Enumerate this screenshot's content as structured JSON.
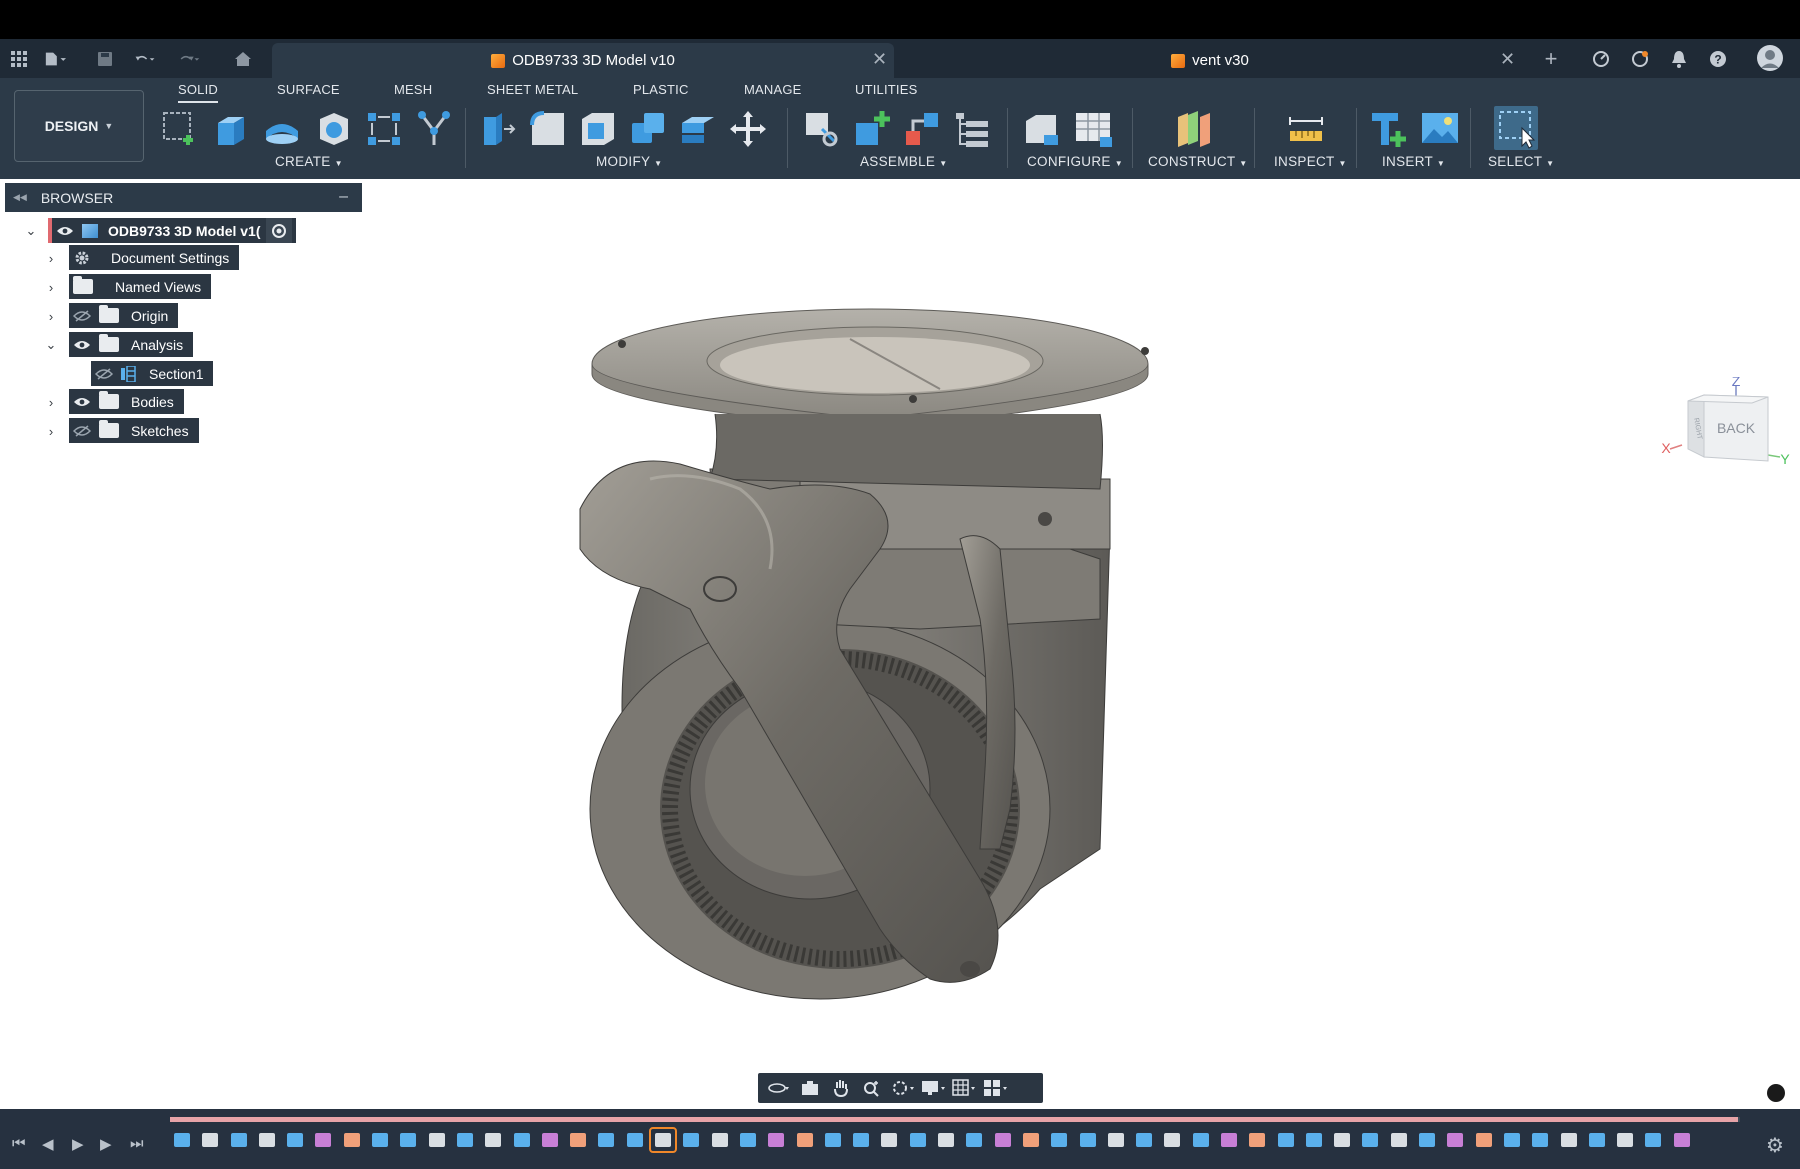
{
  "tabs": {
    "active_title": "ODB9733 3D Model v10",
    "second_title": "vent v30"
  },
  "ribbon": {
    "design_label": "DESIGN",
    "tabs": [
      "SOLID",
      "SURFACE",
      "MESH",
      "SHEET METAL",
      "PLASTIC",
      "MANAGE",
      "UTILITIES"
    ],
    "groups": {
      "create": "CREATE",
      "modify": "MODIFY",
      "assemble": "ASSEMBLE",
      "configure": "CONFIGURE",
      "construct": "CONSTRUCT",
      "inspect": "INSPECT",
      "insert": "INSERT",
      "select": "SELECT"
    }
  },
  "browser": {
    "title": "BROWSER",
    "root": "ODB9733 3D Model v1(",
    "items": [
      {
        "label": "Document Settings"
      },
      {
        "label": "Named Views"
      },
      {
        "label": "Origin"
      },
      {
        "label": "Analysis"
      },
      {
        "label": "Section1"
      },
      {
        "label": "Bodies"
      },
      {
        "label": "Sketches"
      }
    ]
  },
  "viewcube": {
    "face_back": "BACK",
    "face_right": "RIGHT",
    "axis_x": "X",
    "axis_y": "Y",
    "axis_z": "Z"
  },
  "colors": {
    "ribbon_bg": "#2c3a48",
    "tabbar_bg": "#1f2a36",
    "timeline_bg": "#263140",
    "accent_orange": "#f0882a",
    "timeline_progress": "#e6a3a8"
  }
}
